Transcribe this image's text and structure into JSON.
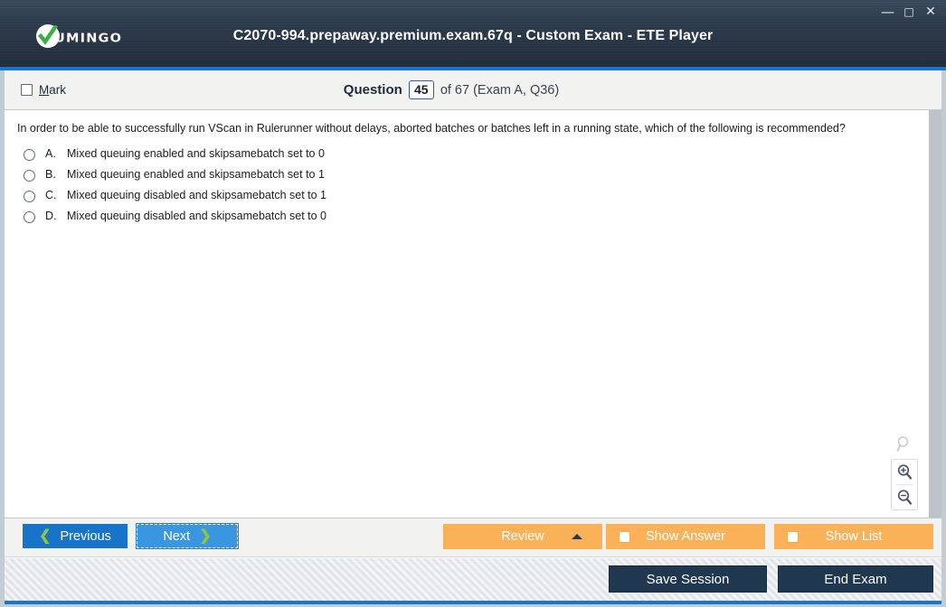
{
  "window": {
    "title": "C2070-994.prepaway.premium.exam.67q - Custom Exam - ETE Player",
    "controls": {
      "minimize": "—",
      "maximize": "□",
      "close": "✕"
    },
    "logo_text": "UMINGO",
    "logo_icon": "green-check-circle-icon"
  },
  "header": {
    "mark_label_prefix": "M",
    "mark_label_rest": "ark",
    "question_word": "Question",
    "question_number": "45",
    "question_rest": "of 67 (Exam A, Q36)"
  },
  "question": {
    "text": "In order to be able to successfully run VScan in Rulerunner without delays, aborted batches or batches left in a running state, which of the following is recommended?",
    "options": [
      {
        "letter": "A.",
        "text": "Mixed queuing enabled and skipsamebatch set to 0",
        "selected": false
      },
      {
        "letter": "B.",
        "text": "Mixed queuing enabled and skipsamebatch set to 1",
        "selected": false
      },
      {
        "letter": "C.",
        "text": "Mixed queuing disabled and skipsamebatch set to 1",
        "selected": false
      },
      {
        "letter": "D.",
        "text": "Mixed queuing disabled and skipsamebatch set to 0",
        "selected": false
      }
    ]
  },
  "zoom_tools": {
    "search_icon": "magnifier-icon",
    "zoom_in_icon": "magnifier-plus-icon",
    "zoom_out_icon": "magnifier-minus-icon"
  },
  "toolbar": {
    "previous_label": "Previous",
    "next_label": "Next",
    "review_label": "Review",
    "show_answer_label": "Show Answer",
    "show_list_label": "Show List"
  },
  "footer": {
    "save_session_label": "Save Session",
    "end_exam_label": "End Exam"
  },
  "colors": {
    "titlebar_dark": "#273444",
    "accent_blue": "#1874d2",
    "nav_blue": "#1874c9",
    "nav_blue_focus": "#3b96e0",
    "chevron_green": "#8ec63f",
    "orange": "#fbb158",
    "dark_navy_button": "#1f3850",
    "content_white": "#ffffff",
    "bar_grey": "#f2f2f0"
  }
}
